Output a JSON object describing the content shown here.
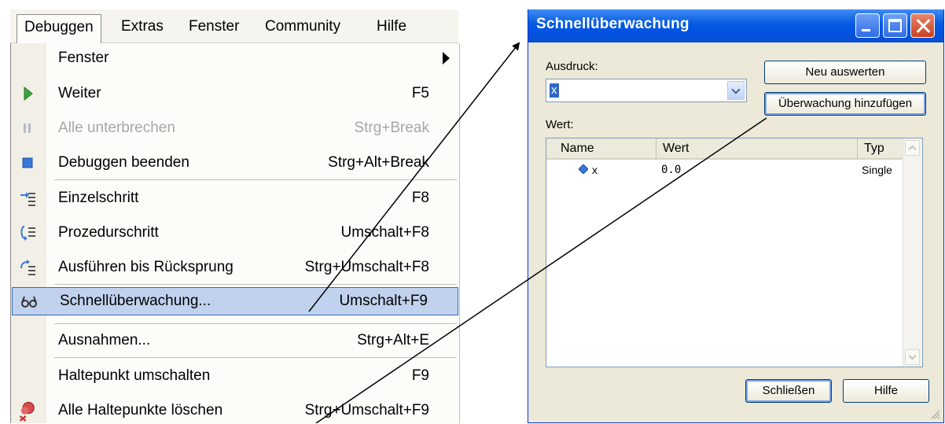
{
  "menubar": {
    "items": [
      {
        "label": "Debuggen"
      },
      {
        "label": "Extras"
      },
      {
        "label": "Fenster"
      },
      {
        "label": "Community"
      },
      {
        "label": "Hilfe"
      }
    ]
  },
  "menu": {
    "items": [
      {
        "label": "Fenster",
        "accel": "",
        "icon": "",
        "submenu": true
      },
      {
        "label": "Weiter",
        "accel": "F5",
        "icon": "play-icon"
      },
      {
        "label": "Alle unterbrechen",
        "accel": "Strg+Break",
        "icon": "pause-icon",
        "disabled": true
      },
      {
        "label": "Debuggen beenden",
        "accel": "Strg+Alt+Break",
        "icon": "stop-icon"
      },
      {
        "label": "Einzelschritt",
        "accel": "F8",
        "icon": "step-into-icon"
      },
      {
        "label": "Prozedurschritt",
        "accel": "Umschalt+F8",
        "icon": "step-over-icon"
      },
      {
        "label": "Ausführen bis Rücksprung",
        "accel": "Strg+Umschalt+F8",
        "icon": "step-out-icon"
      },
      {
        "label": "Schnellüberwachung...",
        "accel": "Umschalt+F9",
        "icon": "quickwatch-icon",
        "highlighted": true
      },
      {
        "label": "Ausnahmen...",
        "accel": "Strg+Alt+E",
        "icon": ""
      },
      {
        "label": "Haltepunkt umschalten",
        "accel": "F9",
        "icon": ""
      },
      {
        "label": "Alle Haltepunkte löschen",
        "accel": "Strg+Umschalt+F9",
        "icon": "clear-breakpoints-icon"
      }
    ]
  },
  "dialog": {
    "title": "Schnellüberwachung",
    "expression_label": "Ausdruck:",
    "expression_value": "x",
    "reevaluate_button": "Neu auswerten",
    "add_watch_button": "Überwachung hinzufügen",
    "value_label": "Wert:",
    "columns": [
      "Name",
      "Wert",
      "Typ"
    ],
    "rows": [
      {
        "name": "x",
        "value": "0.0",
        "type": "Single"
      }
    ],
    "close_button": "Schließen",
    "help_button": "Hilfe"
  },
  "colors": {
    "titlebar": "#0054e3",
    "highlight": "#c1d2ee",
    "dialog_bg": "#ece9d8"
  }
}
